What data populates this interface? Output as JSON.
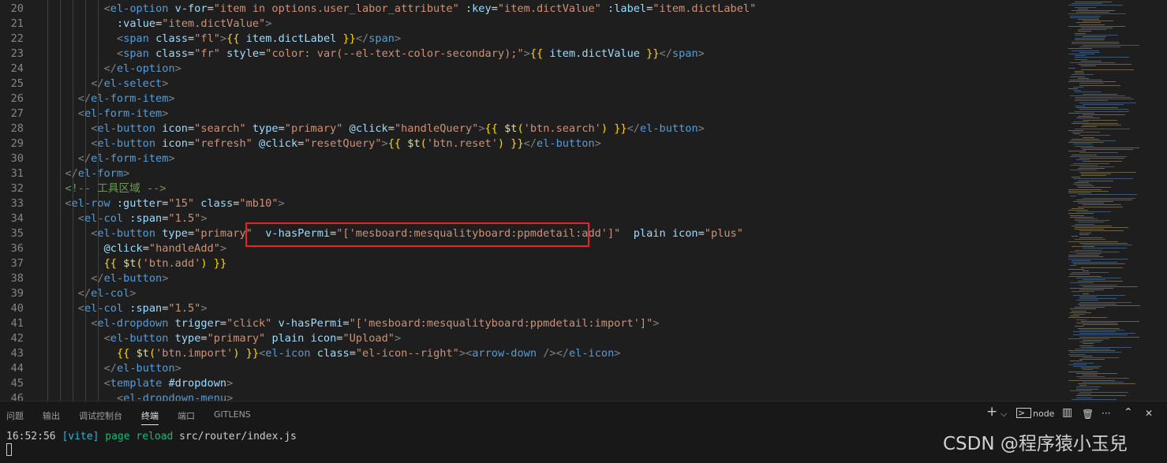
{
  "editor": {
    "lines": [
      {
        "n": "20",
        "i": 9,
        "tokens": [
          [
            "t",
            "<"
          ],
          [
            "g",
            "el-option"
          ],
          [
            "w",
            " "
          ],
          [
            "a",
            "v-for"
          ],
          [
            "w",
            "="
          ],
          [
            "s",
            "\"item in options.user_labor_attribute\""
          ],
          [
            "w",
            " "
          ],
          [
            "a",
            ":key"
          ],
          [
            "w",
            "="
          ],
          [
            "s",
            "\"item.dictValue\""
          ],
          [
            "w",
            " "
          ],
          [
            "a",
            ":label"
          ],
          [
            "w",
            "="
          ],
          [
            "s",
            "\"item.dictLabel\""
          ]
        ]
      },
      {
        "n": "21",
        "i": 10,
        "tokens": [
          [
            "a",
            ":value"
          ],
          [
            "w",
            "="
          ],
          [
            "s",
            "\"item.dictValue\""
          ],
          [
            "t",
            ">"
          ]
        ]
      },
      {
        "n": "22",
        "i": 10,
        "tokens": [
          [
            "t",
            "<"
          ],
          [
            "g",
            "span"
          ],
          [
            "w",
            " "
          ],
          [
            "a",
            "class"
          ],
          [
            "w",
            "="
          ],
          [
            "s",
            "\"fl\""
          ],
          [
            "t",
            ">"
          ],
          [
            "y",
            "{{"
          ],
          [
            "w",
            " "
          ],
          [
            "a",
            "item.dictLabel"
          ],
          [
            "w",
            " "
          ],
          [
            "y",
            "}}"
          ],
          [
            "t",
            "</"
          ],
          [
            "g",
            "span"
          ],
          [
            "t",
            ">"
          ]
        ]
      },
      {
        "n": "23",
        "i": 10,
        "tokens": [
          [
            "t",
            "<"
          ],
          [
            "g",
            "span"
          ],
          [
            "w",
            " "
          ],
          [
            "a",
            "class"
          ],
          [
            "w",
            "="
          ],
          [
            "s",
            "\"fr\""
          ],
          [
            "w",
            " "
          ],
          [
            "a",
            "style"
          ],
          [
            "w",
            "="
          ],
          [
            "s",
            "\"color: var(--el-text-color-secondary);\""
          ],
          [
            "t",
            ">"
          ],
          [
            "y",
            "{{"
          ],
          [
            "w",
            " "
          ],
          [
            "a",
            "item.dictValue"
          ],
          [
            "w",
            " "
          ],
          [
            "y",
            "}}"
          ],
          [
            "t",
            "</"
          ],
          [
            "g",
            "span"
          ],
          [
            "t",
            ">"
          ]
        ]
      },
      {
        "n": "24",
        "i": 9,
        "tokens": [
          [
            "t",
            "</"
          ],
          [
            "g",
            "el-option"
          ],
          [
            "t",
            ">"
          ]
        ]
      },
      {
        "n": "25",
        "i": 8,
        "tokens": [
          [
            "t",
            "</"
          ],
          [
            "g",
            "el-select"
          ],
          [
            "t",
            ">"
          ]
        ]
      },
      {
        "n": "26",
        "i": 7,
        "tokens": [
          [
            "t",
            "</"
          ],
          [
            "g",
            "el-form-item"
          ],
          [
            "t",
            ">"
          ]
        ]
      },
      {
        "n": "27",
        "i": 7,
        "tokens": [
          [
            "t",
            "<"
          ],
          [
            "g",
            "el-form-item"
          ],
          [
            "t",
            ">"
          ]
        ]
      },
      {
        "n": "28",
        "i": 8,
        "tokens": [
          [
            "t",
            "<"
          ],
          [
            "g",
            "el-button"
          ],
          [
            "w",
            " "
          ],
          [
            "a",
            "icon"
          ],
          [
            "w",
            "="
          ],
          [
            "s",
            "\"search\""
          ],
          [
            "w",
            " "
          ],
          [
            "a",
            "type"
          ],
          [
            "w",
            "="
          ],
          [
            "s",
            "\"primary\""
          ],
          [
            "w",
            " "
          ],
          [
            "a",
            "@click"
          ],
          [
            "w",
            "="
          ],
          [
            "s",
            "\"handleQuery\""
          ],
          [
            "t",
            ">"
          ],
          [
            "y",
            "{{"
          ],
          [
            "w",
            " "
          ],
          [
            "f",
            "$t"
          ],
          [
            "y",
            "("
          ],
          [
            "s",
            "'btn.search'"
          ],
          [
            "y",
            ")"
          ],
          [
            "w",
            " "
          ],
          [
            "y",
            "}}"
          ],
          [
            "t",
            "</"
          ],
          [
            "g",
            "el-button"
          ],
          [
            "t",
            ">"
          ]
        ]
      },
      {
        "n": "29",
        "i": 8,
        "tokens": [
          [
            "t",
            "<"
          ],
          [
            "g",
            "el-button"
          ],
          [
            "w",
            " "
          ],
          [
            "a",
            "icon"
          ],
          [
            "w",
            "="
          ],
          [
            "s",
            "\"refresh\""
          ],
          [
            "w",
            " "
          ],
          [
            "a",
            "@click"
          ],
          [
            "w",
            "="
          ],
          [
            "s",
            "\"resetQuery\""
          ],
          [
            "t",
            ">"
          ],
          [
            "y",
            "{{"
          ],
          [
            "w",
            " "
          ],
          [
            "f",
            "$t"
          ],
          [
            "y",
            "("
          ],
          [
            "s",
            "'btn.reset'"
          ],
          [
            "y",
            ")"
          ],
          [
            "w",
            " "
          ],
          [
            "y",
            "}}"
          ],
          [
            "t",
            "</"
          ],
          [
            "g",
            "el-button"
          ],
          [
            "t",
            ">"
          ]
        ]
      },
      {
        "n": "30",
        "i": 7,
        "tokens": [
          [
            "t",
            "</"
          ],
          [
            "g",
            "el-form-item"
          ],
          [
            "t",
            ">"
          ]
        ]
      },
      {
        "n": "31",
        "i": 6,
        "tokens": [
          [
            "t",
            "</"
          ],
          [
            "g",
            "el-form"
          ],
          [
            "t",
            ">"
          ]
        ]
      },
      {
        "n": "32",
        "i": 6,
        "tokens": [
          [
            "c",
            "<!-- 工具区域 -->"
          ]
        ]
      },
      {
        "n": "33",
        "i": 6,
        "tokens": [
          [
            "t",
            "<"
          ],
          [
            "g",
            "el-row"
          ],
          [
            "w",
            " "
          ],
          [
            "a",
            ":gutter"
          ],
          [
            "w",
            "="
          ],
          [
            "s",
            "\"15\""
          ],
          [
            "w",
            " "
          ],
          [
            "a",
            "class"
          ],
          [
            "w",
            "="
          ],
          [
            "s",
            "\"mb10\""
          ],
          [
            "t",
            ">"
          ]
        ]
      },
      {
        "n": "34",
        "i": 7,
        "tokens": [
          [
            "t",
            "<"
          ],
          [
            "g",
            "el-col"
          ],
          [
            "w",
            " "
          ],
          [
            "a",
            ":span"
          ],
          [
            "w",
            "="
          ],
          [
            "s",
            "\"1.5\""
          ],
          [
            "t",
            ">"
          ]
        ]
      },
      {
        "n": "35",
        "i": 8,
        "tokens": [
          [
            "t",
            "<"
          ],
          [
            "g",
            "el-button"
          ],
          [
            "w",
            " "
          ],
          [
            "a",
            "type"
          ],
          [
            "w",
            "="
          ],
          [
            "s",
            "\"primary\""
          ],
          [
            "w",
            "  "
          ],
          [
            "a",
            "v-hasPermi"
          ],
          [
            "w",
            "="
          ],
          [
            "s",
            "\"["
          ],
          [
            "s",
            "'mesboard:mesqualityboard:ppmdetail:add'"
          ],
          [
            "s",
            "]\""
          ],
          [
            "w",
            "  "
          ],
          [
            "a",
            "plain"
          ],
          [
            "w",
            " "
          ],
          [
            "a",
            "icon"
          ],
          [
            "w",
            "="
          ],
          [
            "s",
            "\"plus\""
          ]
        ]
      },
      {
        "n": "36",
        "i": 9,
        "tokens": [
          [
            "a",
            "@click"
          ],
          [
            "w",
            "="
          ],
          [
            "s",
            "\"handleAdd\""
          ],
          [
            "t",
            ">"
          ]
        ]
      },
      {
        "n": "37",
        "i": 9,
        "tokens": [
          [
            "y",
            "{{"
          ],
          [
            "w",
            " "
          ],
          [
            "f",
            "$t"
          ],
          [
            "y",
            "("
          ],
          [
            "s",
            "'btn.add'"
          ],
          [
            "y",
            ")"
          ],
          [
            "w",
            " "
          ],
          [
            "y",
            "}}"
          ]
        ]
      },
      {
        "n": "38",
        "i": 8,
        "tokens": [
          [
            "t",
            "</"
          ],
          [
            "g",
            "el-button"
          ],
          [
            "t",
            ">"
          ]
        ]
      },
      {
        "n": "39",
        "i": 7,
        "tokens": [
          [
            "t",
            "</"
          ],
          [
            "g",
            "el-col"
          ],
          [
            "t",
            ">"
          ]
        ]
      },
      {
        "n": "40",
        "i": 7,
        "tokens": [
          [
            "t",
            "<"
          ],
          [
            "g",
            "el-col"
          ],
          [
            "w",
            " "
          ],
          [
            "a",
            ":span"
          ],
          [
            "w",
            "="
          ],
          [
            "s",
            "\"1.5\""
          ],
          [
            "t",
            ">"
          ]
        ]
      },
      {
        "n": "41",
        "i": 8,
        "tokens": [
          [
            "t",
            "<"
          ],
          [
            "g",
            "el-dropdown"
          ],
          [
            "w",
            " "
          ],
          [
            "a",
            "trigger"
          ],
          [
            "w",
            "="
          ],
          [
            "s",
            "\"click\""
          ],
          [
            "w",
            " "
          ],
          [
            "a",
            "v-hasPermi"
          ],
          [
            "w",
            "="
          ],
          [
            "s",
            "\"["
          ],
          [
            "s",
            "'mesboard:mesqualityboard:ppmdetail:import'"
          ],
          [
            "s",
            "]\""
          ],
          [
            "t",
            ">"
          ]
        ]
      },
      {
        "n": "42",
        "i": 9,
        "tokens": [
          [
            "t",
            "<"
          ],
          [
            "g",
            "el-button"
          ],
          [
            "w",
            " "
          ],
          [
            "a",
            "type"
          ],
          [
            "w",
            "="
          ],
          [
            "s",
            "\"primary\""
          ],
          [
            "w",
            " "
          ],
          [
            "a",
            "plain"
          ],
          [
            "w",
            " "
          ],
          [
            "a",
            "icon"
          ],
          [
            "w",
            "="
          ],
          [
            "s",
            "\"Upload\""
          ],
          [
            "t",
            ">"
          ]
        ]
      },
      {
        "n": "43",
        "i": 10,
        "tokens": [
          [
            "y",
            "{{"
          ],
          [
            "w",
            " "
          ],
          [
            "f",
            "$t"
          ],
          [
            "y",
            "("
          ],
          [
            "s",
            "'btn.import'"
          ],
          [
            "y",
            ")"
          ],
          [
            "w",
            " "
          ],
          [
            "y",
            "}}"
          ],
          [
            "t",
            "<"
          ],
          [
            "g",
            "el-icon"
          ],
          [
            "w",
            " "
          ],
          [
            "a",
            "class"
          ],
          [
            "w",
            "="
          ],
          [
            "s",
            "\"el-icon--right\""
          ],
          [
            "t",
            ">"
          ],
          [
            "t",
            "<"
          ],
          [
            "g",
            "arrow-down"
          ],
          [
            "w",
            " "
          ],
          [
            "t",
            "/>"
          ],
          [
            "t",
            "</"
          ],
          [
            "g",
            "el-icon"
          ],
          [
            "t",
            ">"
          ]
        ]
      },
      {
        "n": "44",
        "i": 9,
        "tokens": [
          [
            "t",
            "</"
          ],
          [
            "g",
            "el-button"
          ],
          [
            "t",
            ">"
          ]
        ]
      },
      {
        "n": "45",
        "i": 9,
        "tokens": [
          [
            "t",
            "<"
          ],
          [
            "g",
            "template"
          ],
          [
            "w",
            " "
          ],
          [
            "a",
            "#dropdown"
          ],
          [
            "t",
            ">"
          ]
        ]
      },
      {
        "n": "46",
        "i": 10,
        "tokens": [
          [
            "t",
            "<"
          ],
          [
            "g",
            "el-dropdown-menu"
          ],
          [
            "t",
            ">"
          ]
        ]
      }
    ]
  },
  "panel": {
    "tabs": [
      "问题",
      "输出",
      "调试控制台",
      "终端",
      "端口",
      "GITLENS"
    ],
    "active_tab": 3,
    "actions": {
      "add": "+",
      "add_menu": "⌵",
      "terminal_name": "node",
      "split": "▥",
      "trash": "🗑",
      "more": "···",
      "maximize": "⌃",
      "close": "✕"
    },
    "terminal_lines": [
      {
        "time": "16:52:56",
        "tag": "[vite]",
        "msg": "page reload",
        "path": "src/router/index.js"
      }
    ]
  },
  "watermark": "CSDN @程序猿小玉兒",
  "colors": {
    "highlight_box": "#e5222d",
    "tag": "#569cd6",
    "attr": "#9cdcfe",
    "string": "#ce9178",
    "comment": "#6a9955",
    "bracket": "#ffd700"
  }
}
